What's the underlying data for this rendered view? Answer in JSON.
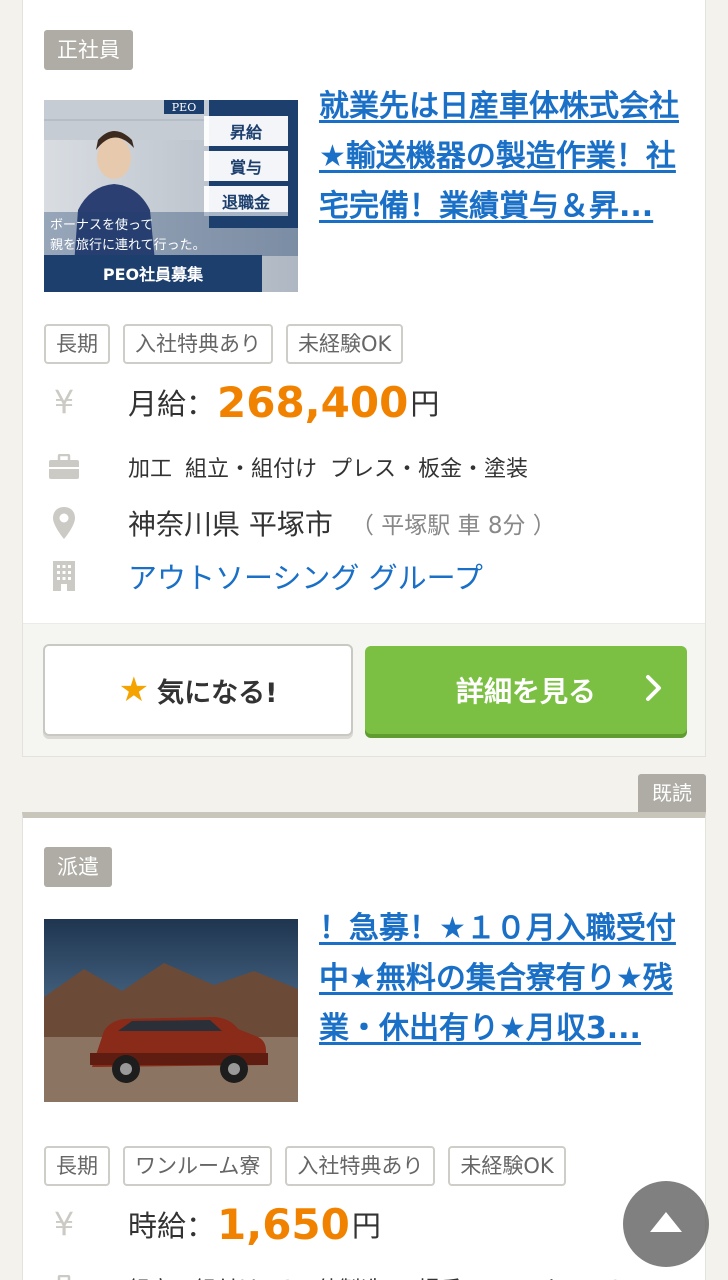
{
  "colors": {
    "title_link": "#1a6fc7",
    "salary": "#f08200",
    "detail_button": "#7bc043",
    "type_tag": "#aeaca4",
    "favorite_star": "#f5a300"
  },
  "icons": [
    "yen-icon",
    "briefcase-icon",
    "map-pin-icon",
    "building-icon",
    "star-icon",
    "chevron-right-icon",
    "arrow-up-icon"
  ],
  "listings": [
    {
      "employment_type": "正社員",
      "title": "就業先は日産車体株式会社★輸送機器の製造作業！社宅完備！業績賞与＆昇...",
      "image": {
        "corner_text": "PEO",
        "benefits": [
          "昇給",
          "賞与",
          "退職金"
        ],
        "caption_line1": "ボーナスを使って",
        "caption_line2": "親を旅行に連れて行った。",
        "banner": "PEO社員募集"
      },
      "tags": [
        "長期",
        "入社特典あり",
        "未経験OK"
      ],
      "salary_label": "月給：",
      "salary_value": "268,400",
      "salary_unit": "円",
      "job_categories": "加工 組立・組付け プレス・板金・塗装",
      "location": "神奈川県 平塚市",
      "station": "（ 平塚駅 車 8分 ）",
      "company": "アウトソーシング グループ",
      "favorite_label": "気になる!",
      "detail_label": "詳細を見る"
    },
    {
      "employment_type": "派遣",
      "read_badge": "既読",
      "title": "！急募！★１０月入職受付中★無料の集合寮有り★残業・休出有り★月収3...",
      "tags": [
        "長期",
        "ワンルーム寮",
        "入社特典あり",
        "未経験OK"
      ],
      "salary_label": "時給：",
      "salary_value": "1,650",
      "salary_unit": "円",
      "job_categories_partial": "組立・組付け その他製造 工場系 フォークリフト"
    }
  ]
}
